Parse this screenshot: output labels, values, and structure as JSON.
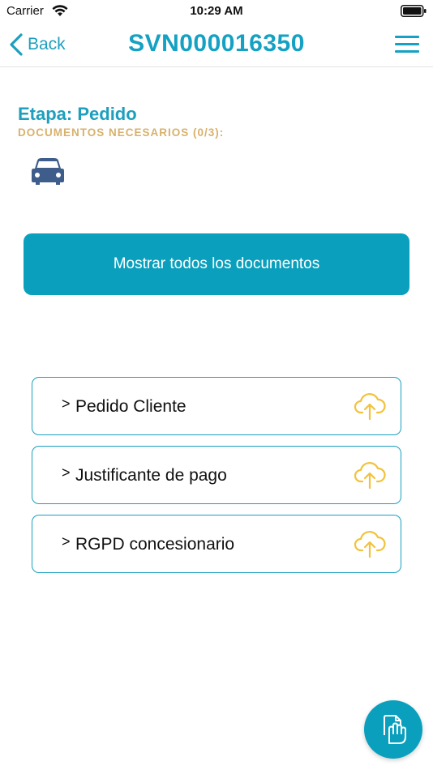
{
  "status_bar": {
    "carrier": "Carrier",
    "time": "10:29 AM"
  },
  "nav": {
    "back_label": "Back",
    "title": "SVN000016350",
    "accent_color": "#14a1c3"
  },
  "stage": {
    "title": "Etapa: Pedido",
    "documents_needed": "DOCUMENTOS NECESARIOS (0/3):",
    "vehicle_icon": "car-icon"
  },
  "show_all_button": {
    "label": "Mostrar todos los documentos",
    "color": "#0aa0bd"
  },
  "documents": [
    {
      "arrow": ">",
      "label": "Pedido Cliente",
      "icon": "cloud-upload-icon"
    },
    {
      "arrow": ">",
      "label": "Justificante de pago",
      "icon": "cloud-upload-icon"
    },
    {
      "arrow": ">",
      "label": "RGPD concesionario",
      "icon": "cloud-upload-icon"
    }
  ],
  "fab": {
    "icon": "document-hand-icon"
  }
}
